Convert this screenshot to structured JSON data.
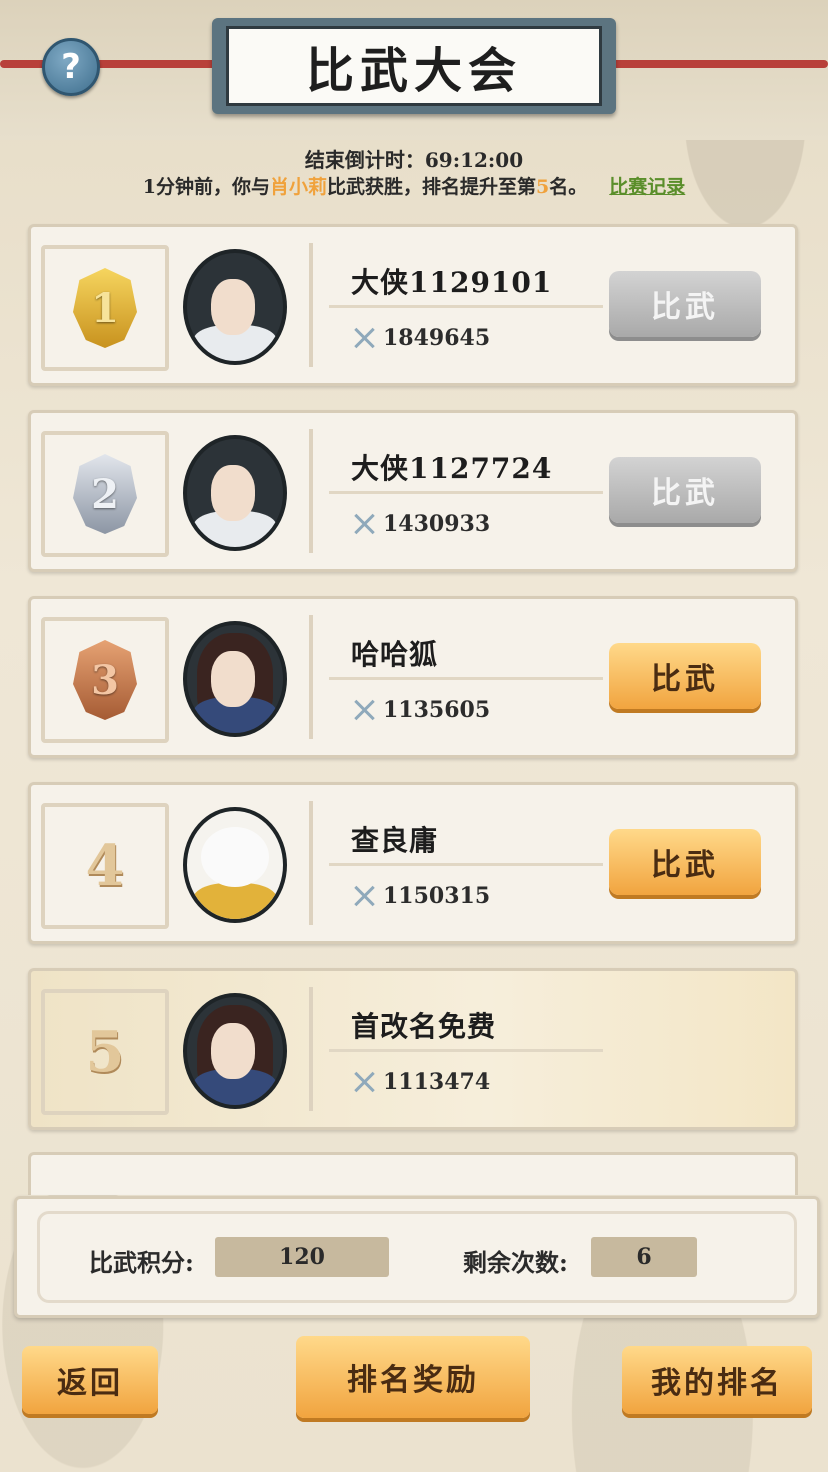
{
  "header": {
    "title": "比武大会",
    "help_icon": "?"
  },
  "countdown": {
    "label": "结束倒计时：",
    "value": "69:12:00"
  },
  "battle_message": {
    "prefix": "1分钟前，你与",
    "opponent": "肖小莉",
    "middle": "比武获胜，排名提升至第",
    "rank": "5",
    "suffix": "名。",
    "record_link": "比赛记录"
  },
  "ranking": [
    {
      "rank": "1",
      "medal": "gold",
      "name": "大侠1129101",
      "power": "1849645",
      "button": "比武",
      "button_state": "disabled"
    },
    {
      "rank": "2",
      "medal": "silver",
      "name": "大侠1127724",
      "power": "1430933",
      "button": "比武",
      "button_state": "disabled"
    },
    {
      "rank": "3",
      "medal": "bronze",
      "name": "哈哈狐",
      "power": "1135605",
      "button": "比武",
      "button_state": "active"
    },
    {
      "rank": "4",
      "medal": "none",
      "name": "查良庸",
      "power": "1150315",
      "button": "比武",
      "button_state": "active"
    },
    {
      "rank": "5",
      "medal": "none",
      "name": "首改名免费",
      "power": "1113474",
      "button": "",
      "button_state": "self"
    }
  ],
  "stats": {
    "points_label": "比武积分:",
    "points_value": "120",
    "remaining_label": "剩余次数:",
    "remaining_value": "6"
  },
  "footer": {
    "back": "返回",
    "rank_rewards": "排名奖励",
    "my_rank": "我的排名"
  },
  "colors": {
    "highlight": "#f0a23c",
    "link": "#5a8e2a",
    "button_gold": "#f1a43f",
    "button_gray": "#a9a9a9"
  }
}
